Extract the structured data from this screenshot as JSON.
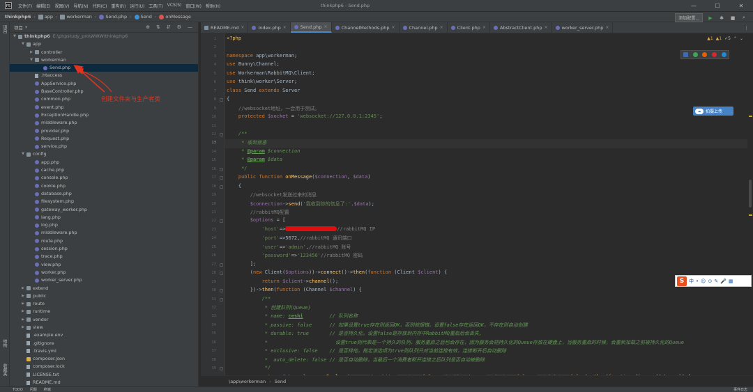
{
  "app": {
    "window_title": "thinkphp6 - Send.php",
    "menu": [
      "文件(F)",
      "编辑(E)",
      "视图(V)",
      "导航(N)",
      "代码(C)",
      "重构(R)",
      "运行(U)",
      "工具(T)",
      "VCS(S)",
      "窗口(W)",
      "帮助(H)"
    ],
    "window_controls": [
      "—",
      "☐",
      "✕"
    ]
  },
  "navbar": {
    "crumbs": [
      "thinkphp6",
      "app",
      "workerman",
      "Send.php",
      "Send",
      "onMessage"
    ],
    "run_config": "添加配置..."
  },
  "left_strip": {
    "top": "项目",
    "bottom": [
      "结构",
      "收藏夹"
    ]
  },
  "project": {
    "header": "项目",
    "root_name": "thinkphp6",
    "root_path": "E:\\phpstudy_pro\\WWW\\thinkphp6",
    "tree": [
      {
        "label": "app",
        "type": "folder",
        "depth": 1,
        "open": true
      },
      {
        "label": "controller",
        "type": "folder",
        "depth": 2,
        "open": false
      },
      {
        "label": "workerman",
        "type": "folder",
        "depth": 2,
        "open": true
      },
      {
        "label": "Send.php",
        "type": "php",
        "depth": 3,
        "selected": true
      },
      {
        "label": ".htaccess",
        "type": "file",
        "depth": 2
      },
      {
        "label": "AppService.php",
        "type": "php",
        "depth": 2
      },
      {
        "label": "BaseController.php",
        "type": "php",
        "depth": 2
      },
      {
        "label": "common.php",
        "type": "php",
        "depth": 2
      },
      {
        "label": "event.php",
        "type": "php",
        "depth": 2
      },
      {
        "label": "ExceptionHandle.php",
        "type": "php",
        "depth": 2
      },
      {
        "label": "middleware.php",
        "type": "php",
        "depth": 2
      },
      {
        "label": "provider.php",
        "type": "php",
        "depth": 2
      },
      {
        "label": "Request.php",
        "type": "php",
        "depth": 2
      },
      {
        "label": "service.php",
        "type": "php",
        "depth": 2
      },
      {
        "label": "config",
        "type": "folder",
        "depth": 1,
        "open": true
      },
      {
        "label": "app.php",
        "type": "php",
        "depth": 2
      },
      {
        "label": "cache.php",
        "type": "php",
        "depth": 2
      },
      {
        "label": "console.php",
        "type": "php",
        "depth": 2
      },
      {
        "label": "cookie.php",
        "type": "php",
        "depth": 2
      },
      {
        "label": "database.php",
        "type": "php",
        "depth": 2
      },
      {
        "label": "filesystem.php",
        "type": "php",
        "depth": 2
      },
      {
        "label": "gateway_worker.php",
        "type": "php",
        "depth": 2
      },
      {
        "label": "lang.php",
        "type": "php",
        "depth": 2
      },
      {
        "label": "log.php",
        "type": "php",
        "depth": 2
      },
      {
        "label": "middleware.php",
        "type": "php",
        "depth": 2
      },
      {
        "label": "route.php",
        "type": "php",
        "depth": 2
      },
      {
        "label": "session.php",
        "type": "php",
        "depth": 2
      },
      {
        "label": "trace.php",
        "type": "php",
        "depth": 2
      },
      {
        "label": "view.php",
        "type": "php",
        "depth": 2
      },
      {
        "label": "worker.php",
        "type": "php",
        "depth": 2
      },
      {
        "label": "worker_server.php",
        "type": "php",
        "depth": 2
      },
      {
        "label": "extend",
        "type": "folder",
        "depth": 1,
        "open": false
      },
      {
        "label": "public",
        "type": "folder",
        "depth": 1,
        "open": false
      },
      {
        "label": "route",
        "type": "folder",
        "depth": 1,
        "open": false
      },
      {
        "label": "runtime",
        "type": "folder",
        "depth": 1,
        "open": false
      },
      {
        "label": "vendor",
        "type": "folder",
        "depth": 1,
        "open": false
      },
      {
        "label": "view",
        "type": "folder",
        "depth": 1,
        "open": false
      },
      {
        "label": ".example.env",
        "type": "file",
        "depth": 1
      },
      {
        "label": ".gitignore",
        "type": "file",
        "depth": 1
      },
      {
        "label": ".travis.yml",
        "type": "file",
        "depth": 1
      },
      {
        "label": "composer.json",
        "type": "json",
        "depth": 1
      },
      {
        "label": "composer.lock",
        "type": "file",
        "depth": 1
      },
      {
        "label": "LICENSE.txt",
        "type": "file",
        "depth": 1
      },
      {
        "label": "README.md",
        "type": "file",
        "depth": 1
      }
    ]
  },
  "annotation": {
    "text": "创建文件夹与生产者类",
    "color": "#e0341f"
  },
  "tabs": [
    {
      "label": "README.md",
      "type": "md"
    },
    {
      "label": "Index.php",
      "type": "php"
    },
    {
      "label": "Send.php",
      "type": "php",
      "active": true
    },
    {
      "label": "ChannelMethods.php",
      "type": "php"
    },
    {
      "label": "Channel.php",
      "type": "php"
    },
    {
      "label": "Client.php",
      "type": "php"
    },
    {
      "label": "AbstractClient.php",
      "type": "php"
    },
    {
      "label": "worker_server.php",
      "type": "php"
    }
  ],
  "inspections": {
    "warnings": "▲1",
    "weak": "▲1",
    "typos": "✓5"
  },
  "translate_widget": {
    "label": "拍摄上传"
  },
  "editor": {
    "current_line": 13,
    "lines": [
      {
        "n": 1,
        "tokens": [
          [
            "ph",
            "<?php"
          ]
        ]
      },
      {
        "n": 2,
        "tokens": []
      },
      {
        "n": 3,
        "tokens": [
          [
            "kw",
            "namespace "
          ],
          [
            "cls",
            "app\\workerman;"
          ]
        ]
      },
      {
        "n": 4,
        "tokens": [
          [
            "kw",
            "use "
          ],
          [
            "cls",
            "Bunny\\Channel;"
          ]
        ]
      },
      {
        "n": 5,
        "tokens": [
          [
            "kw",
            "use "
          ],
          [
            "cls",
            "Workerman\\RabbitMQ\\Client;"
          ]
        ]
      },
      {
        "n": 6,
        "tokens": [
          [
            "kw",
            "use "
          ],
          [
            "cls",
            "think\\worker\\Server;"
          ]
        ]
      },
      {
        "n": 7,
        "tokens": [
          [
            "kw",
            "class "
          ],
          [
            "cls",
            "Send "
          ],
          [
            "kw",
            "extends "
          ],
          [
            "cls",
            "Server"
          ]
        ]
      },
      {
        "n": 8,
        "tokens": [
          [
            "cls",
            "{"
          ]
        ]
      },
      {
        "n": 9,
        "tokens": [
          [
            "cm",
            "    //websocket地址，一会用于测试。"
          ]
        ]
      },
      {
        "n": 10,
        "tokens": [
          [
            "kw",
            "    protected "
          ],
          [
            "vr",
            "$socket"
          ],
          [
            "cls",
            " = "
          ],
          [
            "st",
            "'websocket://127.0.0.1:2345'"
          ],
          [
            "cls",
            ";"
          ]
        ]
      },
      {
        "n": 11,
        "tokens": []
      },
      {
        "n": 12,
        "tokens": [
          [
            "dc",
            "    /**"
          ]
        ]
      },
      {
        "n": 13,
        "tokens": [
          [
            "dc",
            "     * 收到信息"
          ]
        ]
      },
      {
        "n": 14,
        "tokens": [
          [
            "dc",
            "     * "
          ],
          [
            "dt",
            "@param"
          ],
          [
            "dc",
            " $connection"
          ]
        ]
      },
      {
        "n": 15,
        "tokens": [
          [
            "dc",
            "     * "
          ],
          [
            "dt",
            "@param"
          ],
          [
            "dc",
            " $data"
          ]
        ]
      },
      {
        "n": 16,
        "tokens": [
          [
            "dc",
            "     */"
          ]
        ]
      },
      {
        "n": 17,
        "tokens": [
          [
            "kw",
            "    public function "
          ],
          [
            "fn",
            "onMessage"
          ],
          [
            "cls",
            "("
          ],
          [
            "vr",
            "$connection"
          ],
          [
            "cls",
            ", "
          ],
          [
            "vr",
            "$data"
          ],
          [
            "cls",
            ")"
          ]
        ]
      },
      {
        "n": 18,
        "tokens": [
          [
            "cls",
            "    {"
          ]
        ]
      },
      {
        "n": 19,
        "tokens": [
          [
            "cm",
            "        //websocket发送过来的消息"
          ]
        ]
      },
      {
        "n": 20,
        "tokens": [
          [
            "vr",
            "        $connection"
          ],
          [
            "cls",
            "->"
          ],
          [
            "fn",
            "send"
          ],
          [
            "cls",
            "("
          ],
          [
            "st",
            "'我收到你的信息了:'"
          ],
          [
            "cls",
            "."
          ],
          [
            "vr",
            "$data"
          ],
          [
            "cls",
            ");"
          ]
        ]
      },
      {
        "n": 21,
        "tokens": [
          [
            "cm",
            "        //rabbitMQ配置"
          ]
        ]
      },
      {
        "n": 22,
        "tokens": [
          [
            "vr",
            "        $options"
          ],
          [
            "cls",
            " = ["
          ]
        ]
      },
      {
        "n": 23,
        "tokens": [
          [
            "st",
            "            'host'"
          ],
          [
            "cls",
            "=>"
          ],
          [
            "redact",
            ""
          ],
          [
            "cm",
            "//rabbitMQ IP"
          ]
        ]
      },
      {
        "n": 24,
        "tokens": [
          [
            "st",
            "            'port'"
          ],
          [
            "cls",
            "=>5672,"
          ],
          [
            "cm",
            "//rabbitMQ 通讯端口"
          ]
        ]
      },
      {
        "n": 25,
        "tokens": [
          [
            "st",
            "            'user'"
          ],
          [
            "cls",
            "=>"
          ],
          [
            "st",
            "'admin'"
          ],
          [
            "cls",
            ","
          ],
          [
            "cm",
            "//rabbitMQ 账号"
          ]
        ]
      },
      {
        "n": 26,
        "tokens": [
          [
            "st",
            "            'password'"
          ],
          [
            "cls",
            "=>"
          ],
          [
            "st",
            "'123456'"
          ],
          [
            "cm",
            "//rabbitMQ 密码"
          ]
        ]
      },
      {
        "n": 27,
        "tokens": [
          [
            "cls",
            "        ];"
          ]
        ]
      },
      {
        "n": 28,
        "tokens": [
          [
            "cls",
            "        ("
          ],
          [
            "kw",
            "new "
          ],
          [
            "cls",
            "Client("
          ],
          [
            "vr",
            "$options"
          ],
          [
            "cls",
            "))->"
          ],
          [
            "fn",
            "connect"
          ],
          [
            "cls",
            "()->"
          ],
          [
            "fn",
            "then"
          ],
          [
            "cls",
            "("
          ],
          [
            "kw",
            "function "
          ],
          [
            "cls",
            "(Client "
          ],
          [
            "vr",
            "$client"
          ],
          [
            "cls",
            ") {"
          ]
        ]
      },
      {
        "n": 29,
        "tokens": [
          [
            "kw",
            "            return "
          ],
          [
            "vr",
            "$client"
          ],
          [
            "cls",
            "->"
          ],
          [
            "fn",
            "channel"
          ],
          [
            "cls",
            "();"
          ]
        ]
      },
      {
        "n": 30,
        "tokens": [
          [
            "cls",
            "        })->"
          ],
          [
            "fn",
            "then"
          ],
          [
            "cls",
            "("
          ],
          [
            "kw",
            "function "
          ],
          [
            "cls",
            "(Channel "
          ],
          [
            "vr",
            "$channel"
          ],
          [
            "cls",
            ") {"
          ]
        ]
      },
      {
        "n": 31,
        "tokens": [
          [
            "dc",
            "            /**"
          ]
        ]
      },
      {
        "n": 32,
        "tokens": [
          [
            "dc",
            "             * 创建队列(Queue)"
          ]
        ]
      },
      {
        "n": 33,
        "tokens": [
          [
            "dc",
            "             * name: "
          ],
          [
            "dt",
            "ceshi"
          ],
          [
            "dc",
            "         // 队列名称"
          ]
        ]
      },
      {
        "n": 34,
        "tokens": [
          [
            "dc",
            "             * passive: false      // 如果设置true存在则返回OK，否则就报错。设置false存在返回OK，不存在则自动创建"
          ]
        ]
      },
      {
        "n": 35,
        "tokens": [
          [
            "dc",
            "             * durable: true       // 是否持久化，设置false是存放到内存中RabbitMQ重启后会丢失,"
          ]
        ]
      },
      {
        "n": 36,
        "tokens": [
          [
            "dc",
            "             *                       设置true则代表是一个持久的队列，服务重启之后也会存在，因为服务会把持久化的Queue存放在硬盘上，当服务重启的时候，会重新加载之前被持久化的Queue"
          ]
        ]
      },
      {
        "n": 37,
        "tokens": [
          [
            "dc",
            "             * exclusive: false    // 是否排他，指定该选项为true则队列只对当前连接有效，连接断开后自动删除"
          ]
        ]
      },
      {
        "n": 38,
        "tokens": [
          [
            "dc",
            "             *  auto_delete: false // 是否自动删除，当最后一个消费者断开连接之后队列是否自动被删除"
          ]
        ]
      },
      {
        "n": 39,
        "tokens": [
          [
            "dc",
            "             */"
          ]
        ]
      },
      {
        "n": 40,
        "tokens": [
          [
            "kw",
            "            return "
          ],
          [
            "vr",
            "$channel"
          ],
          [
            "cls",
            "->"
          ],
          [
            "fn",
            "queueDeclare"
          ],
          [
            "cls",
            "("
          ],
          [
            "hint",
            "queue: "
          ],
          [
            "st",
            "'ceshi'"
          ],
          [
            "cls",
            ", "
          ],
          [
            "hint",
            "passive: "
          ],
          [
            "kw",
            "false"
          ],
          [
            "cls",
            ", "
          ],
          [
            "hint",
            "durable: "
          ],
          [
            "kw",
            "true"
          ],
          [
            "cls",
            ", "
          ],
          [
            "hint",
            "exclusive: "
          ],
          [
            "kw",
            "false"
          ],
          [
            "cls",
            ", "
          ],
          [
            "hint",
            "autoDelete: "
          ],
          [
            "kw",
            "false"
          ],
          [
            "cls",
            ")->"
          ],
          [
            "fn",
            "then"
          ],
          [
            "cls",
            "("
          ],
          [
            "kw",
            "function "
          ],
          [
            "cls",
            "() "
          ],
          [
            "kw",
            "use "
          ],
          [
            "cls",
            "("
          ],
          [
            "vr",
            "$channel"
          ],
          [
            "cls",
            ") {"
          ]
        ]
      }
    ]
  },
  "breadcrumb": [
    "\\app\\workerman",
    "Send"
  ],
  "ime": {
    "logo": "S",
    "items": [
      "中",
      "•",
      "☺",
      "⊙",
      "✎",
      "🎤",
      "▦"
    ]
  },
  "status": {
    "left": [
      "TODO",
      "问题",
      "终端"
    ],
    "right": "事件日志"
  },
  "colors": {
    "accent": "#4a88c7",
    "background": "#2b2b2b",
    "panel": "#3c3f41",
    "annotation": "#e0341f"
  }
}
